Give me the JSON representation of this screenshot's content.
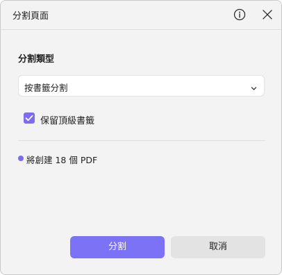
{
  "dialog": {
    "title": "分割頁面"
  },
  "icons": {
    "info": "info-icon",
    "close": "close-icon",
    "chevron": "chevron-down-icon",
    "check": "check-icon",
    "bullet": "dot-icon"
  },
  "split_type": {
    "label": "分割類型",
    "selected": "按書籤分割"
  },
  "options": {
    "keep_bookmarks_label": "保留頂級書籤",
    "keep_bookmarks_checked": true
  },
  "summary": {
    "text": "將創建 18 個 PDF"
  },
  "buttons": {
    "split": "分割",
    "cancel": "取消"
  },
  "colors": {
    "accent": "#7b72f5",
    "background": "#f3f3f3",
    "secondary_button": "#e3e3e3"
  }
}
